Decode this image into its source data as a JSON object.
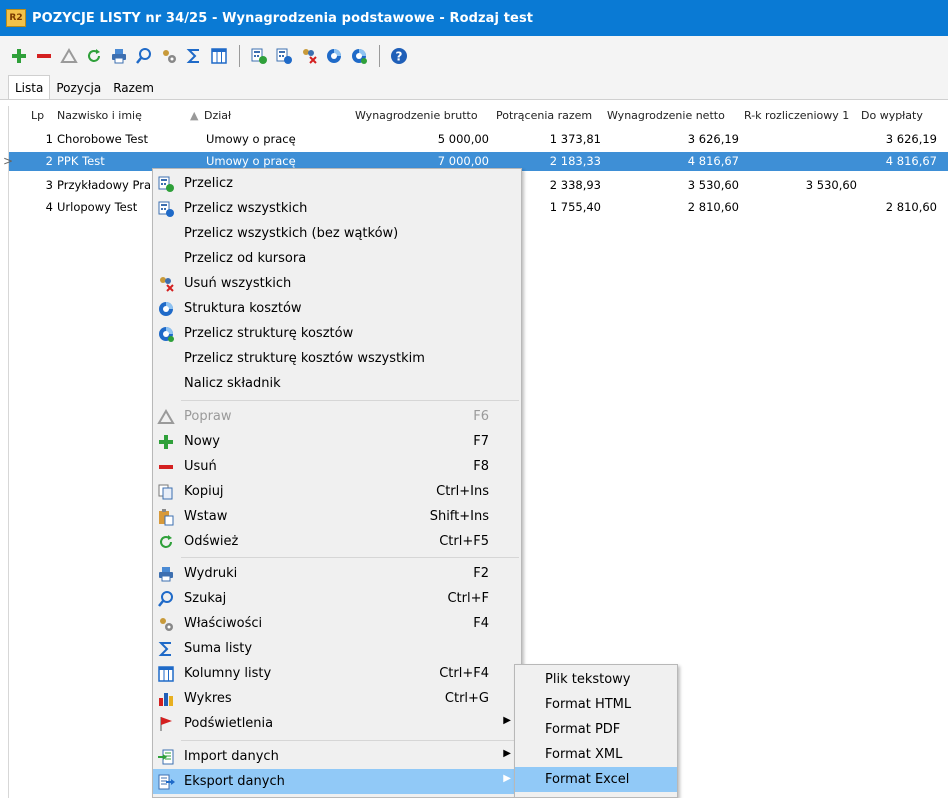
{
  "window": {
    "app_badge": "R2",
    "title": "POZYCJE LISTY nr 34/25 - Wynagrodzenia podstawowe - Rodzaj test"
  },
  "toolbar": {
    "icons": [
      "add-icon",
      "remove-icon",
      "edit-icon",
      "refresh-icon",
      "print-icon",
      "search-icon",
      "properties-icon",
      "sum-icon",
      "columns-icon",
      "recalculate-icon",
      "recalculate-all-icon",
      "delete-all-icon",
      "cost-structure-icon",
      "recalculate-cost-structure-icon",
      "help-icon"
    ]
  },
  "tabs": [
    {
      "label": "Lista",
      "active": true
    },
    {
      "label": "Pozycja",
      "active": false
    },
    {
      "label": "Razem",
      "active": false
    }
  ],
  "grid": {
    "columns": [
      "Lp",
      "Nazwisko i imię",
      "Dział",
      "Wynagrodzenie brutto",
      "Potrącenia razem",
      "Wynagrodzenie netto",
      "R-k rozliczeniowy 1",
      "Do wypłaty"
    ],
    "rows": [
      {
        "lp": "1",
        "name": "Chorobowe Test",
        "dept": "Umowy o pracę",
        "gross": "5 000,00",
        "deductions": "1 373,81",
        "net": "3 626,19",
        "rk": "",
        "payout": "3 626,19",
        "selected": false
      },
      {
        "lp": "2",
        "name": "PPK Test",
        "dept": "Umowy o pracę",
        "gross": "7 000,00",
        "deductions": "2 183,33",
        "net": "4 816,67",
        "rk": "",
        "payout": "4 816,67",
        "selected": true
      },
      {
        "lp": "3",
        "name": "Przykładowy Pra",
        "dept": "",
        "gross": "",
        "deductions": "2 338,93",
        "net": "3 530,60",
        "rk": "3 530,60",
        "payout": "",
        "selected": false
      },
      {
        "lp": "4",
        "name": "Urlopowy Test",
        "dept": "",
        "gross": "",
        "deductions": "1 755,40",
        "net": "2 810,60",
        "rk": "",
        "payout": "2 810,60",
        "selected": false
      }
    ]
  },
  "context_menu": {
    "items": [
      {
        "label": "Przelicz",
        "shortcut": "",
        "icon": "recalculate-icon"
      },
      {
        "label": "Przelicz wszystkich",
        "shortcut": "",
        "icon": "recalculate-all-icon"
      },
      {
        "label": "Przelicz wszystkich (bez wątków)",
        "shortcut": "",
        "icon": ""
      },
      {
        "label": "Przelicz od kursora",
        "shortcut": "",
        "icon": ""
      },
      {
        "label": "Usuń wszystkich",
        "shortcut": "",
        "icon": "delete-all-icon"
      },
      {
        "label": "Struktura kosztów",
        "shortcut": "",
        "icon": "cost-structure-icon"
      },
      {
        "label": "Przelicz strukturę kosztów",
        "shortcut": "",
        "icon": "recalculate-cost-structure-icon"
      },
      {
        "label": "Przelicz strukturę kosztów wszystkim",
        "shortcut": "",
        "icon": ""
      },
      {
        "label": "Nalicz składnik",
        "shortcut": "",
        "icon": ""
      },
      {
        "label": "Popraw",
        "shortcut": "F6",
        "icon": "edit-icon",
        "disabled": true
      },
      {
        "label": "Nowy",
        "shortcut": "F7",
        "icon": "add-icon"
      },
      {
        "label": "Usuń",
        "shortcut": "F8",
        "icon": "remove-icon"
      },
      {
        "label": "Kopiuj",
        "shortcut": "Ctrl+Ins",
        "icon": "copy-icon"
      },
      {
        "label": "Wstaw",
        "shortcut": "Shift+Ins",
        "icon": "paste-icon"
      },
      {
        "label": "Odśwież",
        "shortcut": "Ctrl+F5",
        "icon": "refresh-icon"
      },
      {
        "label": "Wydruki",
        "shortcut": "F2",
        "icon": "print-icon"
      },
      {
        "label": "Szukaj",
        "shortcut": "Ctrl+F",
        "icon": "search-icon"
      },
      {
        "label": "Właściwości",
        "shortcut": "F4",
        "icon": "properties-icon"
      },
      {
        "label": "Suma listy",
        "shortcut": "",
        "icon": "sum-icon"
      },
      {
        "label": "Kolumny listy",
        "shortcut": "Ctrl+F4",
        "icon": "columns-icon"
      },
      {
        "label": "Wykres",
        "shortcut": "Ctrl+G",
        "icon": "chart-icon"
      },
      {
        "label": "Podświetlenia",
        "shortcut": "",
        "icon": "flag-icon",
        "submenu": true
      },
      {
        "label": "Import danych",
        "shortcut": "",
        "icon": "import-icon",
        "submenu": true
      },
      {
        "label": "Eksport danych",
        "shortcut": "",
        "icon": "export-icon",
        "submenu": true,
        "highlighted": true
      }
    ]
  },
  "export_submenu": {
    "items": [
      {
        "label": "Plik tekstowy"
      },
      {
        "label": "Format HTML"
      },
      {
        "label": "Format PDF"
      },
      {
        "label": "Format XML"
      },
      {
        "label": "Format Excel",
        "highlighted": true
      }
    ]
  },
  "colors": {
    "titlebar": "#0a7ad4",
    "selection": "#3e8fd6",
    "menu_highlight": "#91c9f7"
  }
}
